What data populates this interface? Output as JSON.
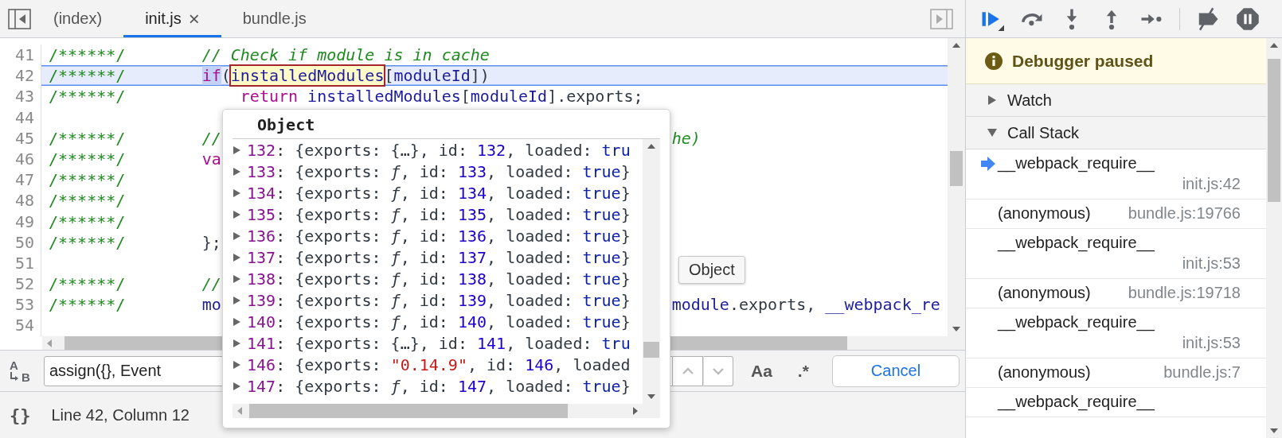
{
  "tabs": [
    {
      "label": "(index)",
      "selected": false
    },
    {
      "label": "init.js",
      "selected": true,
      "close": "×"
    },
    {
      "label": "bundle.js",
      "selected": false
    }
  ],
  "editor": {
    "lines": [
      {
        "number": "41",
        "current": false,
        "prefix": "/******/",
        "code": [
          {
            "kind": "comment",
            "text": "// Check if module is in cache"
          }
        ]
      },
      {
        "number": "42",
        "current": true,
        "prefix": "/******/",
        "code": [
          {
            "kind": "selection",
            "text": "if"
          },
          {
            "kind": "punct",
            "text": "("
          },
          {
            "kind": "hover",
            "text": "installedModules"
          },
          {
            "kind": "punct",
            "text": "["
          },
          {
            "kind": "name",
            "text": "moduleId"
          },
          {
            "kind": "punct",
            "text": "])"
          }
        ]
      },
      {
        "number": "43",
        "current": false,
        "prefix": "/******/",
        "code": [
          {
            "kind": "keyword",
            "text": "    return "
          },
          {
            "kind": "name",
            "text": "installedModules"
          },
          {
            "kind": "punct",
            "text": "["
          },
          {
            "kind": "name",
            "text": "moduleId"
          },
          {
            "kind": "punct",
            "text": "].exports;"
          }
        ]
      },
      {
        "number": "44",
        "current": false
      },
      {
        "number": "45",
        "current": false,
        "prefix": "/******/",
        "code": [
          {
            "kind": "comment",
            "text": "//"
          }
        ],
        "tail": [
          {
            "kind": "comment",
            "text": "he)"
          }
        ]
      },
      {
        "number": "46",
        "current": false,
        "prefix": "/******/",
        "code": [
          {
            "kind": "keyword",
            "text": "va"
          }
        ]
      },
      {
        "number": "47",
        "current": false,
        "prefix": "/******/"
      },
      {
        "number": "48",
        "current": false,
        "prefix": "/******/"
      },
      {
        "number": "49",
        "current": false,
        "prefix": "/******/"
      },
      {
        "number": "50",
        "current": false,
        "prefix": "/******/",
        "code": [
          {
            "kind": "punct",
            "text": "};"
          }
        ]
      },
      {
        "number": "51",
        "current": false
      },
      {
        "number": "52",
        "current": false,
        "prefix": "/******/",
        "code": [
          {
            "kind": "comment",
            "text": "//"
          }
        ]
      },
      {
        "number": "53",
        "current": false,
        "prefix": "/******/",
        "code": [
          {
            "kind": "name",
            "text": "mo"
          }
        ],
        "tail": [
          {
            "kind": "name",
            "text": "module"
          },
          {
            "kind": "punct",
            "text": ".exports, "
          },
          {
            "kind": "name",
            "text": "__webpack_re"
          }
        ]
      },
      {
        "number": "54",
        "current": false
      }
    ]
  },
  "popover": {
    "title": "Object",
    "tooltip": "Object",
    "rows": [
      {
        "expanded": false,
        "tokens": [
          {
            "kind": "key",
            "text": "132"
          },
          {
            "kind": "punct",
            "text": ": {exports: {…}, id: "
          },
          {
            "kind": "number",
            "text": "132"
          },
          {
            "kind": "punct",
            "text": ", loaded: "
          },
          {
            "kind": "bool",
            "text": "tru"
          }
        ]
      },
      {
        "expanded": false,
        "tokens": [
          {
            "kind": "key",
            "text": "133"
          },
          {
            "kind": "punct",
            "text": ": {exports: "
          },
          {
            "kind": "function",
            "text": "ƒ"
          },
          {
            "kind": "punct",
            "text": ", id: "
          },
          {
            "kind": "number",
            "text": "133"
          },
          {
            "kind": "punct",
            "text": ", loaded: "
          },
          {
            "kind": "bool",
            "text": "true"
          },
          {
            "kind": "punct",
            "text": "}"
          }
        ]
      },
      {
        "expanded": false,
        "tokens": [
          {
            "kind": "key",
            "text": "134"
          },
          {
            "kind": "punct",
            "text": ": {exports: "
          },
          {
            "kind": "function",
            "text": "ƒ"
          },
          {
            "kind": "punct",
            "text": ", id: "
          },
          {
            "kind": "number",
            "text": "134"
          },
          {
            "kind": "punct",
            "text": ", loaded: "
          },
          {
            "kind": "bool",
            "text": "true"
          },
          {
            "kind": "punct",
            "text": "}"
          }
        ]
      },
      {
        "expanded": false,
        "tokens": [
          {
            "kind": "key",
            "text": "135"
          },
          {
            "kind": "punct",
            "text": ": {exports: "
          },
          {
            "kind": "function",
            "text": "ƒ"
          },
          {
            "kind": "punct",
            "text": ", id: "
          },
          {
            "kind": "number",
            "text": "135"
          },
          {
            "kind": "punct",
            "text": ", loaded: "
          },
          {
            "kind": "bool",
            "text": "true"
          },
          {
            "kind": "punct",
            "text": "}"
          }
        ]
      },
      {
        "expanded": false,
        "tokens": [
          {
            "kind": "key",
            "text": "136"
          },
          {
            "kind": "punct",
            "text": ": {exports: "
          },
          {
            "kind": "function",
            "text": "ƒ"
          },
          {
            "kind": "punct",
            "text": ", id: "
          },
          {
            "kind": "number",
            "text": "136"
          },
          {
            "kind": "punct",
            "text": ", loaded: "
          },
          {
            "kind": "bool",
            "text": "true"
          },
          {
            "kind": "punct",
            "text": "}"
          }
        ]
      },
      {
        "expanded": false,
        "tokens": [
          {
            "kind": "key",
            "text": "137"
          },
          {
            "kind": "punct",
            "text": ": {exports: "
          },
          {
            "kind": "function",
            "text": "ƒ"
          },
          {
            "kind": "punct",
            "text": ", id: "
          },
          {
            "kind": "number",
            "text": "137"
          },
          {
            "kind": "punct",
            "text": ", loaded: "
          },
          {
            "kind": "bool",
            "text": "true"
          },
          {
            "kind": "punct",
            "text": "}"
          }
        ]
      },
      {
        "expanded": false,
        "tokens": [
          {
            "kind": "key",
            "text": "138"
          },
          {
            "kind": "punct",
            "text": ": {exports: "
          },
          {
            "kind": "function",
            "text": "ƒ"
          },
          {
            "kind": "punct",
            "text": ", id: "
          },
          {
            "kind": "number",
            "text": "138"
          },
          {
            "kind": "punct",
            "text": ", loaded: "
          },
          {
            "kind": "bool",
            "text": "true"
          },
          {
            "kind": "punct",
            "text": "}"
          }
        ]
      },
      {
        "expanded": false,
        "tokens": [
          {
            "kind": "key",
            "text": "139"
          },
          {
            "kind": "punct",
            "text": ": {exports: "
          },
          {
            "kind": "function",
            "text": "ƒ"
          },
          {
            "kind": "punct",
            "text": ", id: "
          },
          {
            "kind": "number",
            "text": "139"
          },
          {
            "kind": "punct",
            "text": ", loaded: "
          },
          {
            "kind": "bool",
            "text": "true"
          },
          {
            "kind": "punct",
            "text": "}"
          }
        ]
      },
      {
        "expanded": false,
        "tokens": [
          {
            "kind": "key",
            "text": "140"
          },
          {
            "kind": "punct",
            "text": ": {exports: "
          },
          {
            "kind": "function",
            "text": "ƒ"
          },
          {
            "kind": "punct",
            "text": ", id: "
          },
          {
            "kind": "number",
            "text": "140"
          },
          {
            "kind": "punct",
            "text": ", loaded: "
          },
          {
            "kind": "bool",
            "text": "true"
          },
          {
            "kind": "punct",
            "text": "}"
          }
        ]
      },
      {
        "expanded": false,
        "tokens": [
          {
            "kind": "key",
            "text": "141"
          },
          {
            "kind": "punct",
            "text": ": {exports: {…}, id: "
          },
          {
            "kind": "number",
            "text": "141"
          },
          {
            "kind": "punct",
            "text": ", loaded: "
          },
          {
            "kind": "bool",
            "text": "tru"
          }
        ]
      },
      {
        "expanded": false,
        "tokens": [
          {
            "kind": "key",
            "text": "146"
          },
          {
            "kind": "punct",
            "text": ": {exports: "
          },
          {
            "kind": "string",
            "text": "\"0.14.9\""
          },
          {
            "kind": "punct",
            "text": ", id: "
          },
          {
            "kind": "number",
            "text": "146"
          },
          {
            "kind": "punct",
            "text": ", loaded"
          }
        ]
      },
      {
        "expanded": false,
        "tokens": [
          {
            "kind": "key",
            "text": "147"
          },
          {
            "kind": "punct",
            "text": ": {exports: "
          },
          {
            "kind": "function",
            "text": "ƒ"
          },
          {
            "kind": "punct",
            "text": ", id: "
          },
          {
            "kind": "number",
            "text": "147"
          },
          {
            "kind": "punct",
            "text": ", loaded: "
          },
          {
            "kind": "bool",
            "text": "true"
          },
          {
            "kind": "punct",
            "text": "}"
          }
        ]
      }
    ]
  },
  "search": {
    "replace_letters": [
      "A",
      "B"
    ],
    "value": "assign({}, Event",
    "match_case": "Aa",
    "regex": ".*",
    "cancel": "Cancel"
  },
  "status_bar": {
    "pretty_print": "{}",
    "position": "Line 42, Column 12"
  },
  "debugger": {
    "banner": "Debugger paused",
    "sections": [
      {
        "title": "Watch",
        "expanded": false
      },
      {
        "title": "Call Stack",
        "expanded": true
      }
    ],
    "call_stack": [
      {
        "function": "__webpack_require__",
        "location": "init.js:42",
        "selected": true
      },
      {
        "function": "(anonymous)",
        "location": "bundle.js:19766",
        "selected": false
      },
      {
        "function": "__webpack_require__",
        "location": "init.js:53",
        "selected": false
      },
      {
        "function": "(anonymous)",
        "location": "bundle.js:19718",
        "selected": false
      },
      {
        "function": "__webpack_require__",
        "location": "init.js:53",
        "selected": false
      },
      {
        "function": "(anonymous)",
        "location": "bundle.js:7",
        "selected": false
      },
      {
        "function": "__webpack_require__",
        "selected": false
      }
    ]
  }
}
